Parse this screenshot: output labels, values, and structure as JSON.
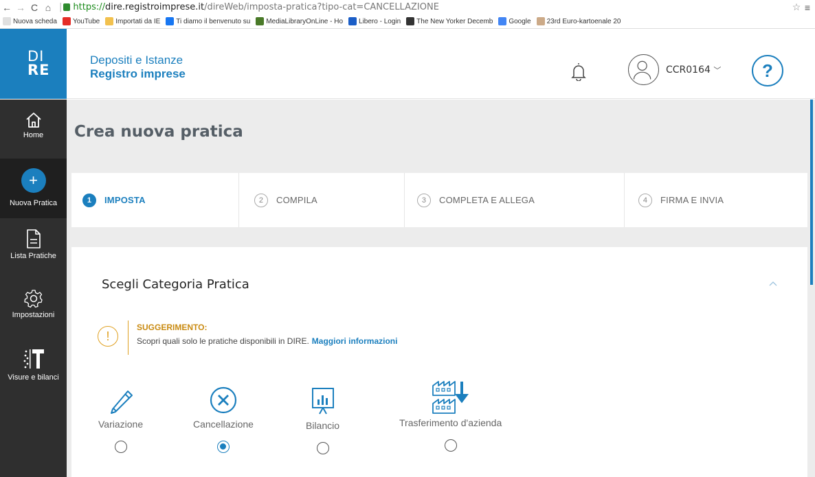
{
  "browser": {
    "url_proto": "https://",
    "url_host": "dire.registroimprese.it",
    "url_path": "/direWeb/imposta-pratica?tipo-cat=CANCELLAZIONE"
  },
  "bookmarks": [
    {
      "label": "Nuova scheda",
      "color": "#e0e0e0"
    },
    {
      "label": "YouTube",
      "color": "#e52d27"
    },
    {
      "label": "Importati da IE",
      "color": "#f2c14e"
    },
    {
      "label": "Ti diamo il benvenuto su",
      "color": "#1877f2"
    },
    {
      "label": "MediaLibraryOnLine - Ho",
      "color": "#4a7a28"
    },
    {
      "label": "Libero - Login",
      "color": "#1b5ec7"
    },
    {
      "label": "The New Yorker Decemb",
      "color": "#333333"
    },
    {
      "label": "Google",
      "color": "#4285f4"
    },
    {
      "label": "23rd Euro-kartoenale 20",
      "color": "#ccaa88"
    }
  ],
  "header": {
    "logo_line1": "DI",
    "logo_line2": "RE",
    "title": "Depositi e Istanze",
    "subtitle": "Registro imprese",
    "user": "CCR0164",
    "help": "?"
  },
  "sidebar": {
    "items": [
      {
        "label": "Home",
        "icon": "home-icon"
      },
      {
        "label": "Nuova Pratica",
        "icon": "plus-icon"
      },
      {
        "label": "Lista Pratiche",
        "icon": "document-icon"
      },
      {
        "label": "Impostazioni",
        "icon": "gear-icon"
      },
      {
        "label": "Visure e bilanci",
        "icon": "visure-icon"
      }
    ]
  },
  "main": {
    "page_title": "Crea nuova pratica",
    "steps": [
      {
        "num": "1",
        "label": "IMPOSTA",
        "active": true
      },
      {
        "num": "2",
        "label": "COMPILA",
        "active": false
      },
      {
        "num": "3",
        "label": "COMPLETA E ALLEGA",
        "active": false
      },
      {
        "num": "4",
        "label": "FIRMA E INVIA",
        "active": false
      }
    ],
    "card_title": "Scegli Categoria Pratica",
    "tip_heading": "SUGGERIMENTO:",
    "tip_text": "Scopri quali solo le pratiche disponibili in DIRE.",
    "tip_link": "Maggiori informazioni",
    "categories": [
      {
        "label": "Variazione",
        "icon": "pencil-icon",
        "selected": false
      },
      {
        "label": "Cancellazione",
        "icon": "cancel-circle-icon",
        "selected": true
      },
      {
        "label": "Bilancio",
        "icon": "chart-board-icon",
        "selected": false
      },
      {
        "label": "Trasferimento d'azienda",
        "icon": "factory-transfer-icon",
        "selected": false
      }
    ]
  },
  "colors": {
    "accent": "#1b7fbe",
    "sidebar": "#2f2f2f",
    "warning": "#e0a020"
  }
}
